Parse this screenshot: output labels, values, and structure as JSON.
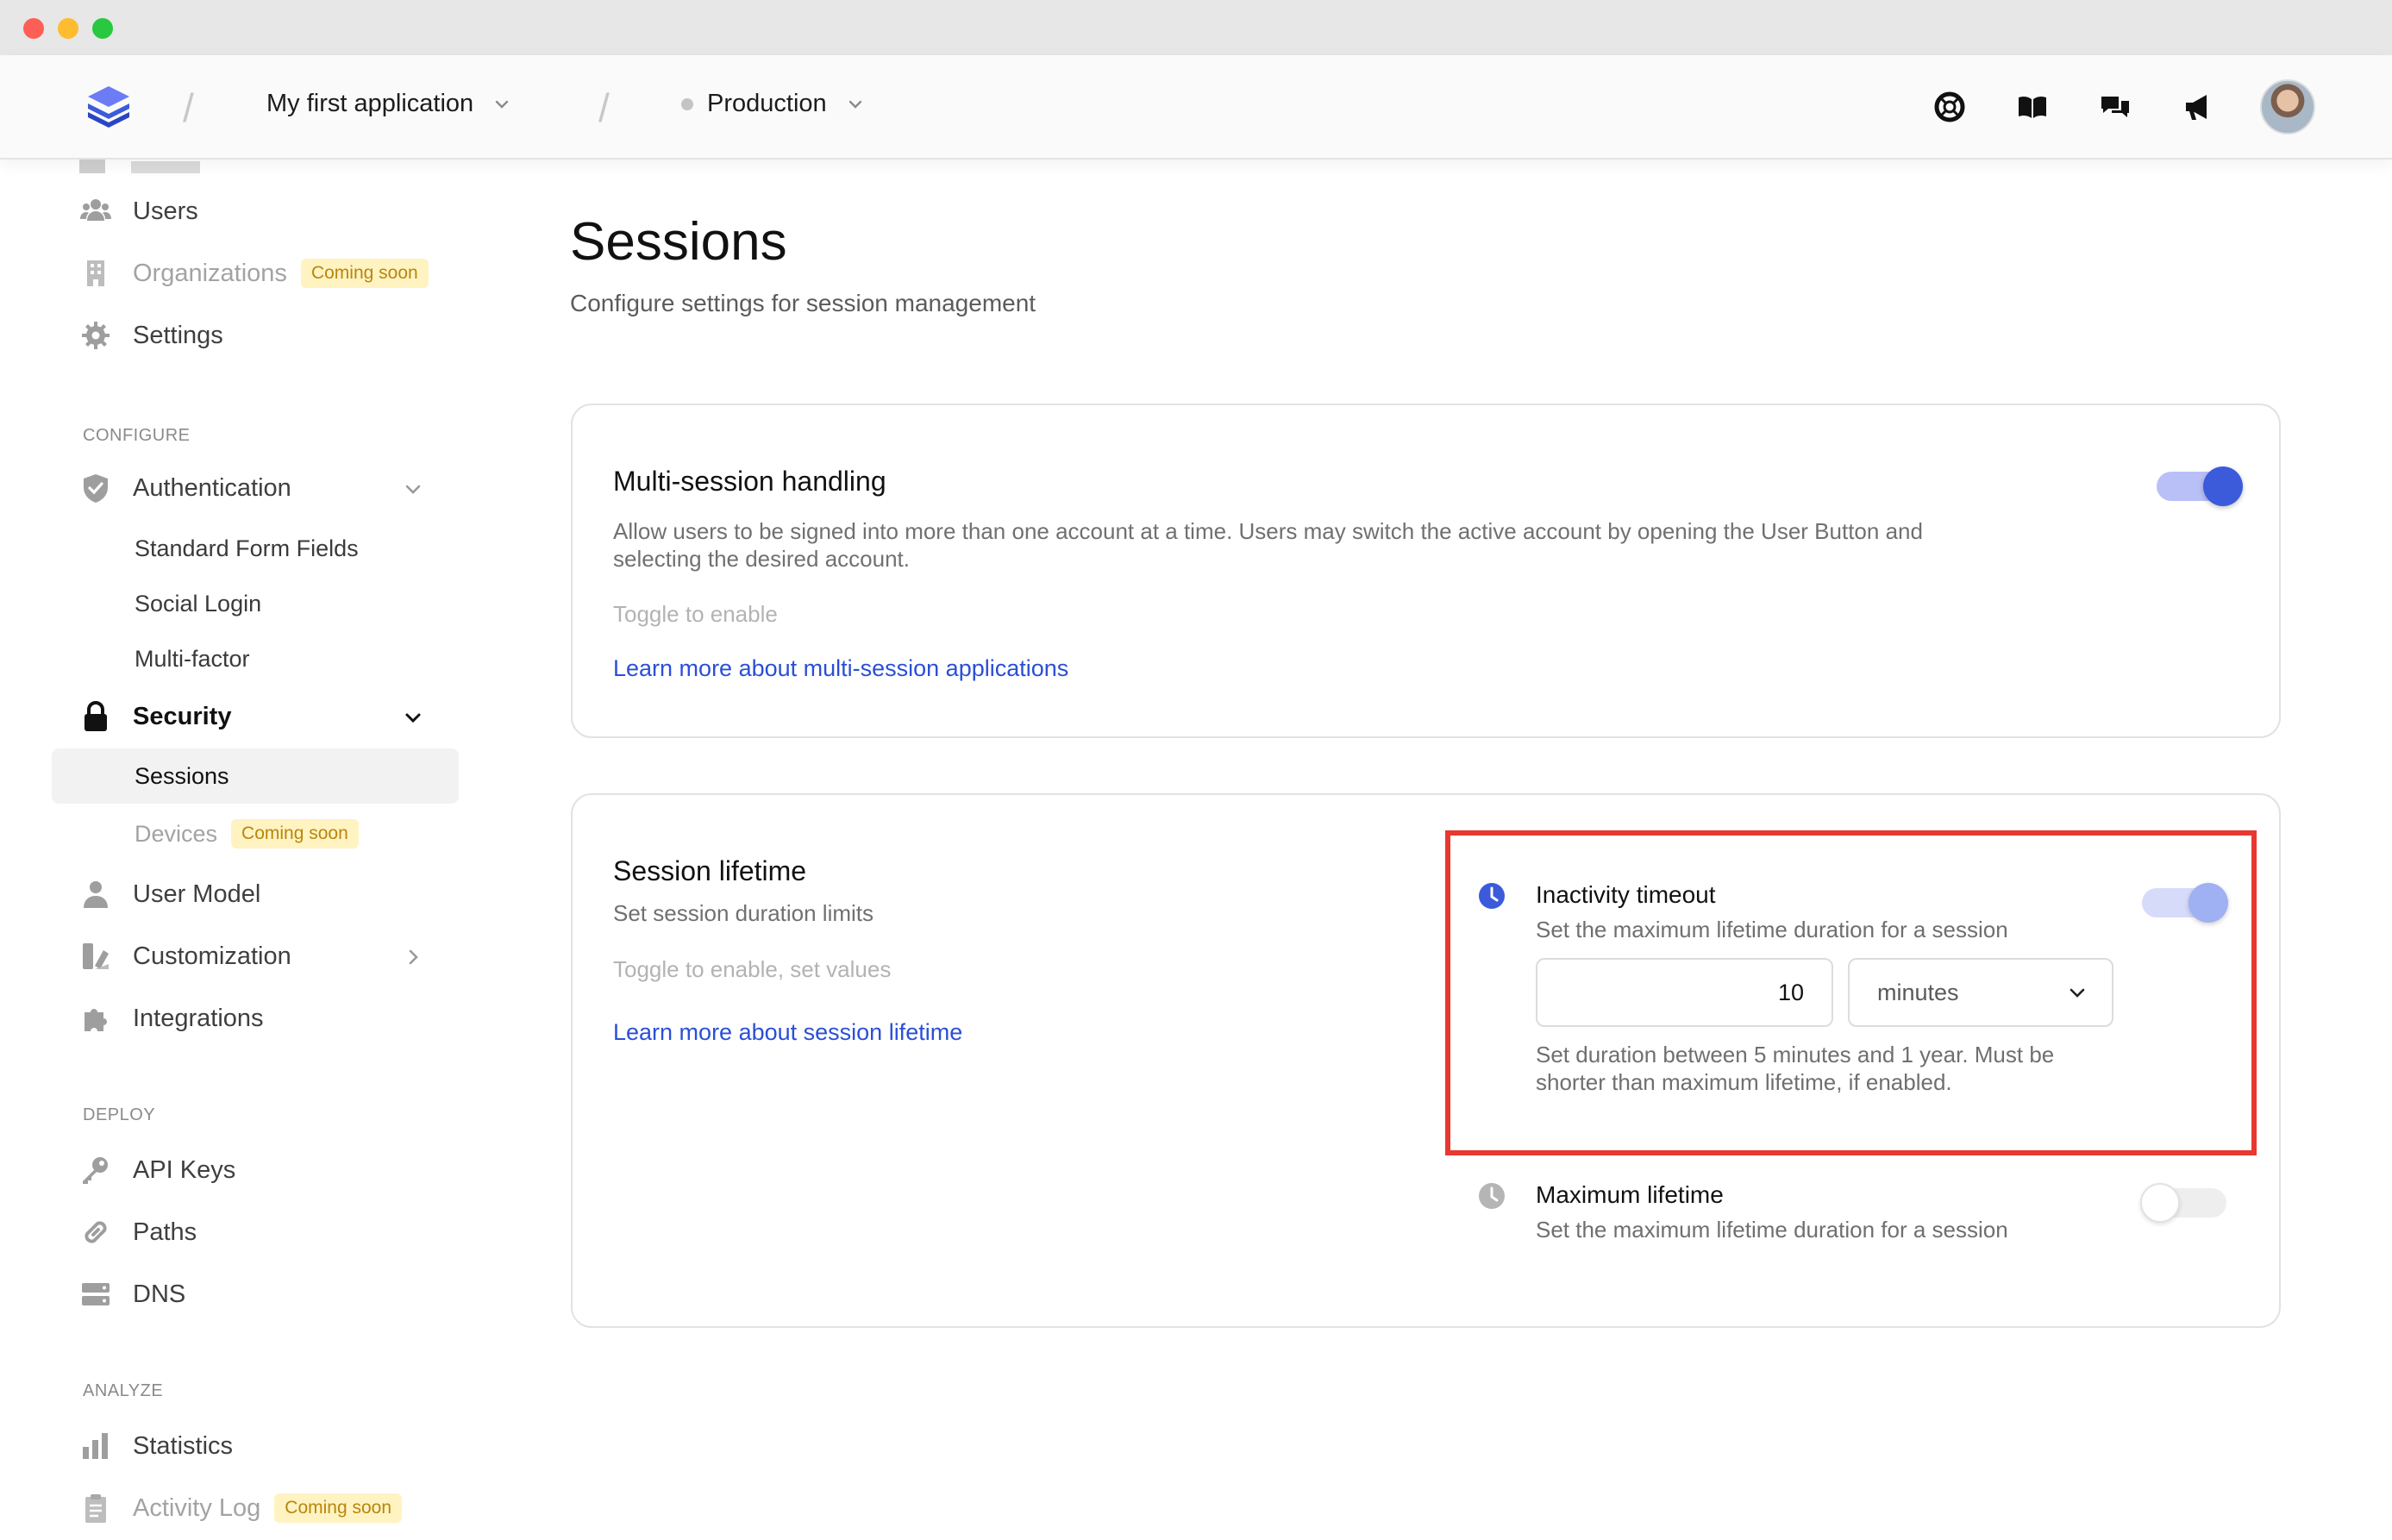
{
  "header": {
    "app_name": "My first application",
    "environment": "Production",
    "icons": [
      "support-icon",
      "docs-icon",
      "chat-icon",
      "announcement-icon"
    ]
  },
  "sidebar": {
    "top_items": [
      {
        "label": "Users",
        "icon": "users-icon"
      },
      {
        "label": "Organizations",
        "icon": "building-icon",
        "badge": "Coming soon"
      },
      {
        "label": "Settings",
        "icon": "gear-icon"
      }
    ],
    "configure_label": "CONFIGURE",
    "authentication": {
      "label": "Authentication",
      "children": [
        "Standard Form Fields",
        "Social Login",
        "Multi-factor"
      ]
    },
    "security": {
      "label": "Security",
      "children": [
        {
          "label": "Sessions",
          "active": true
        },
        {
          "label": "Devices",
          "badge": "Coming soon"
        }
      ]
    },
    "user_model": "User Model",
    "customization": "Customization",
    "integrations": "Integrations",
    "deploy_label": "DEPLOY",
    "deploy_items": [
      "API Keys",
      "Paths",
      "DNS"
    ],
    "analyze_label": "ANALYZE",
    "analyze_items": [
      {
        "label": "Statistics"
      },
      {
        "label": "Activity Log",
        "badge": "Coming soon"
      }
    ]
  },
  "page": {
    "title": "Sessions",
    "subtitle": "Configure settings for session management"
  },
  "multi_session": {
    "title": "Multi-session handling",
    "description_line1": "Allow users to be signed into more than one account at a time. Users may switch the active account by opening the User Button and",
    "description_line2": "selecting the desired account.",
    "hint": "Toggle to enable",
    "link": "Learn more about multi-session applications",
    "enabled": true
  },
  "session_lifetime": {
    "title": "Session lifetime",
    "subtitle": "Set session duration limits",
    "hint": "Toggle to enable, set values",
    "link": "Learn more about session lifetime",
    "inactivity": {
      "title": "Inactivity timeout",
      "description": "Set the maximum lifetime duration for a session",
      "value": "10",
      "unit": "minutes",
      "help_line1": "Set duration between 5 minutes and 1 year. Must be",
      "help_line2": "shorter than maximum lifetime, if enabled.",
      "enabled": true
    },
    "maximum": {
      "title": "Maximum lifetime",
      "description": "Set the maximum lifetime duration for a session",
      "enabled": false
    }
  },
  "colors": {
    "accent": "#3b5bdb",
    "link": "#2a4fd6",
    "highlight": "#e8382f",
    "badge_bg": "#fff3c2",
    "badge_text": "#b8860b"
  }
}
